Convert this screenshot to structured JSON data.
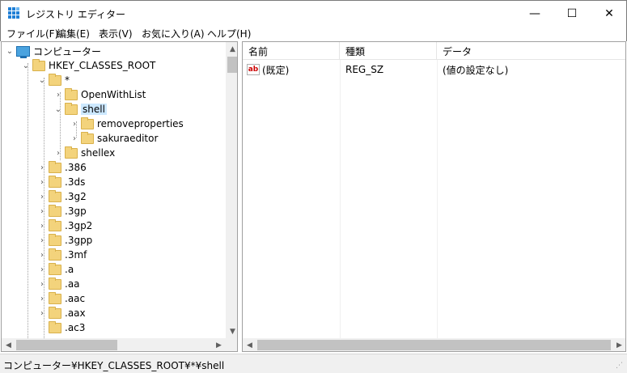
{
  "window": {
    "title": "レジストリ エディター",
    "minimize": "—",
    "maximize": "☐",
    "close": "✕"
  },
  "menu": [
    "ファイル(F)",
    "編集(E)",
    "表示(V)",
    "お気に入り(A)",
    "ヘルプ(H)"
  ],
  "tree": {
    "root": "コンピューター",
    "hive": "HKEY_CLASSES_ROOT",
    "star": "*",
    "openwithlist": "OpenWithList",
    "shell": "shell",
    "removeproperties": "removeproperties",
    "sakuraeditor": "sakuraeditor",
    "shellex": "shellex",
    "extensions": [
      ".386",
      ".3ds",
      ".3g2",
      ".3gp",
      ".3gp2",
      ".3gpp",
      ".3mf",
      ".a",
      ".aa",
      ".aac",
      ".aax",
      ".ac3"
    ]
  },
  "list": {
    "columns": [
      "名前",
      "種類",
      "データ"
    ],
    "rows": [
      {
        "name": "(既定)",
        "type": "REG_SZ",
        "data": "(値の設定なし)",
        "icon": "ab"
      }
    ]
  },
  "status": "コンピューター¥HKEY_CLASSES_ROOT¥*¥shell",
  "icons": {
    "app": "registry-editor-icon",
    "expanded": "chevron-down-icon",
    "collapsed": "chevron-right-icon",
    "folder": "folder-icon"
  },
  "colors": {
    "selection": "#cce8ff",
    "folder": "#f3d37c",
    "scroll_thumb": "#c2c2c2"
  }
}
